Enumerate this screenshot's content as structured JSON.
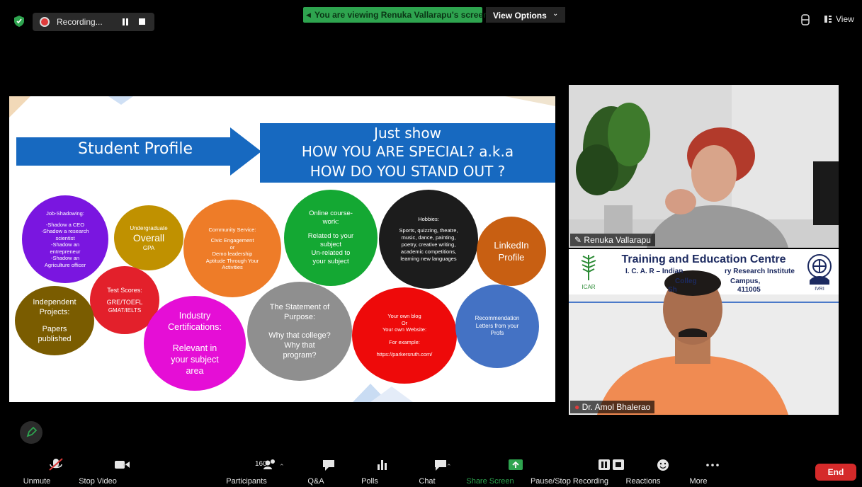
{
  "top_bar": {
    "recording_label": "Recording...",
    "viewing_banner": "You are viewing Renuka Vallarapu's screen",
    "view_options_label": "View Options",
    "view_label": "View"
  },
  "slide": {
    "student_profile": "Student Profile",
    "just_show": "Just show",
    "how_special": "HOW YOU ARE SPECIAL? a.k.a",
    "how_stand_out": "HOW DO YOU STAND OUT ?",
    "bubbles": {
      "job_shadowing": [
        "Job-Shadowing:",
        "-Shadow a CEO",
        "-Shadow a research",
        "scientist",
        "-Shadow an",
        "entrepreneur",
        "-Shadow an",
        "Agriculture officer"
      ],
      "undergrad": [
        "Undergraduate",
        "Overall",
        "GPA"
      ],
      "community": [
        "Community Service:",
        "Civic Engagement",
        "or",
        "Demo leadership",
        "Aptitude Through Your",
        "Activities"
      ],
      "online_course": [
        "Online course-",
        "work:",
        "Related to your",
        "subject",
        "Un-related to",
        "your subject"
      ],
      "hobbies": [
        "Hobbies:",
        "Sports, quizzing, theatre,",
        "music, dance, painting,",
        "poetry, creative writing,",
        "academic competitions,",
        "learning new languages"
      ],
      "linkedin": [
        "LinkedIn",
        "Profile"
      ],
      "test_scores": [
        "Test Scores:",
        "GRE/TOEFL",
        "GMAT/IELTS"
      ],
      "independent": [
        "Independent",
        "Projects:",
        "Papers",
        "published"
      ],
      "industry": [
        "Industry",
        "Certifications:",
        "Relevant in",
        "your subject",
        "area"
      ],
      "sop": [
        "The Statement of",
        "Purpose:",
        "Why that college?",
        "Why that",
        "program?"
      ],
      "blog": [
        "Your own blog",
        "Or",
        "Your own Website:",
        "For example:",
        "https://parkersruth.com/"
      ],
      "recommendation": [
        "Recommendation",
        "Letters from your",
        "Profs"
      ]
    }
  },
  "participants": {
    "presenter_name": "Renuka Vallarapu",
    "second_name": "Dr. Amol Bhalerao",
    "tec_title": "Training and Education Centre",
    "tec_line1": "I. C. A. R – Indian",
    "tec_line1b": "ry Research Institute",
    "tec_line2": "Colleg",
    "tec_line2b": "Campus,",
    "tec_line3": "Sh",
    "tec_line3b": "411005",
    "logo_left_text": "ICAR",
    "logo_right_text": "IVRI"
  },
  "toolbar": {
    "unmute": "Unmute",
    "stop_video": "Stop Video",
    "participants": "Participants",
    "participant_count": "160",
    "qa": "Q&A",
    "polls": "Polls",
    "chat": "Chat",
    "share_screen": "Share Screen",
    "pause_stop": "Pause/Stop Recording",
    "reactions": "Reactions",
    "more": "More",
    "end": "End"
  },
  "colors": {
    "share_green": "#2ea44f",
    "end_red": "#d52a2a",
    "slide_blue": "#1769c0"
  }
}
